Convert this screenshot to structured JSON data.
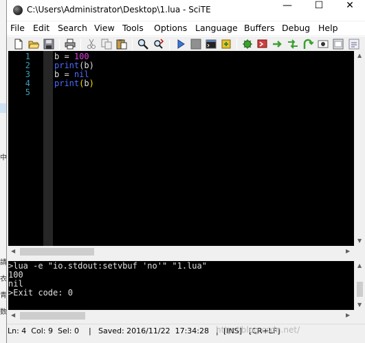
{
  "window": {
    "title": "C:\\Users\\Administrator\\Desktop\\1.lua - SciTE",
    "minimize_glyph": "—",
    "maximize_glyph": "☐",
    "close_glyph": "✕"
  },
  "background_chars": [
    "中",
    "請",
    "衣",
    "青",
    "数"
  ],
  "menu": [
    "File",
    "Edit",
    "Search",
    "View",
    "Tools",
    "Options",
    "Language",
    "Buffers",
    "Debug",
    "Help"
  ],
  "toolbar_icons": [
    "new-file-icon",
    "open-folder-icon",
    "save-icon",
    "print-icon",
    "cut-icon",
    "copy-icon",
    "paste-icon",
    "find-icon",
    "replace-icon",
    "compile-icon",
    "stop-icon",
    "terminal-icon",
    "build-icon",
    "bookmark-icon",
    "next-bookmark-icon",
    "previous-bookmark-icon",
    "go-icon",
    "jump-icon",
    "toggle-output-icon",
    "fullscreen-icon",
    "more-icon"
  ],
  "editor": {
    "line_numbers": [
      "1",
      "2",
      "3",
      "4",
      "5"
    ],
    "lines": [
      [
        {
          "t": "b = ",
          "c": "#e0e0e0"
        },
        {
          "t": "100",
          "c": "#e040e0"
        }
      ],
      [
        {
          "t": "print",
          "c": "#4c6cff"
        },
        {
          "t": "(b)",
          "c": "#e0e0e0"
        }
      ],
      [
        {
          "t": "b = ",
          "c": "#e0e0e0"
        },
        {
          "t": "nil",
          "c": "#4c6cff"
        }
      ],
      [
        {
          "t": "print",
          "c": "#4c6cff"
        },
        {
          "t": "(",
          "c": "#ffe000"
        },
        {
          "t": "b",
          "c": "#e0e0e0"
        },
        {
          "t": ")",
          "c": "#ffe000"
        }
      ],
      []
    ]
  },
  "output": {
    "lines": [
      ">lua -e \"io.stdout:setvbuf 'no'\" \"1.lua\"",
      "100",
      "nil",
      ">Exit code: 0"
    ]
  },
  "status": {
    "position": "Ln: 4  Col: 9  Sel: 0",
    "sep1": "|",
    "saved": "Saved: 2016/11/22  17:34:28",
    "sep2": "|",
    "mode": "[INS]",
    "eol": "[CR+LF]",
    "watermark": "http://blog.csdn.net/"
  },
  "colors": {
    "editor_bg": "#000000",
    "line_number": "#3aa0b8",
    "keyword": "#4c6cff",
    "number": "#e040e0",
    "brace_highlight": "#ffe000",
    "default_text": "#e0e0e0"
  }
}
